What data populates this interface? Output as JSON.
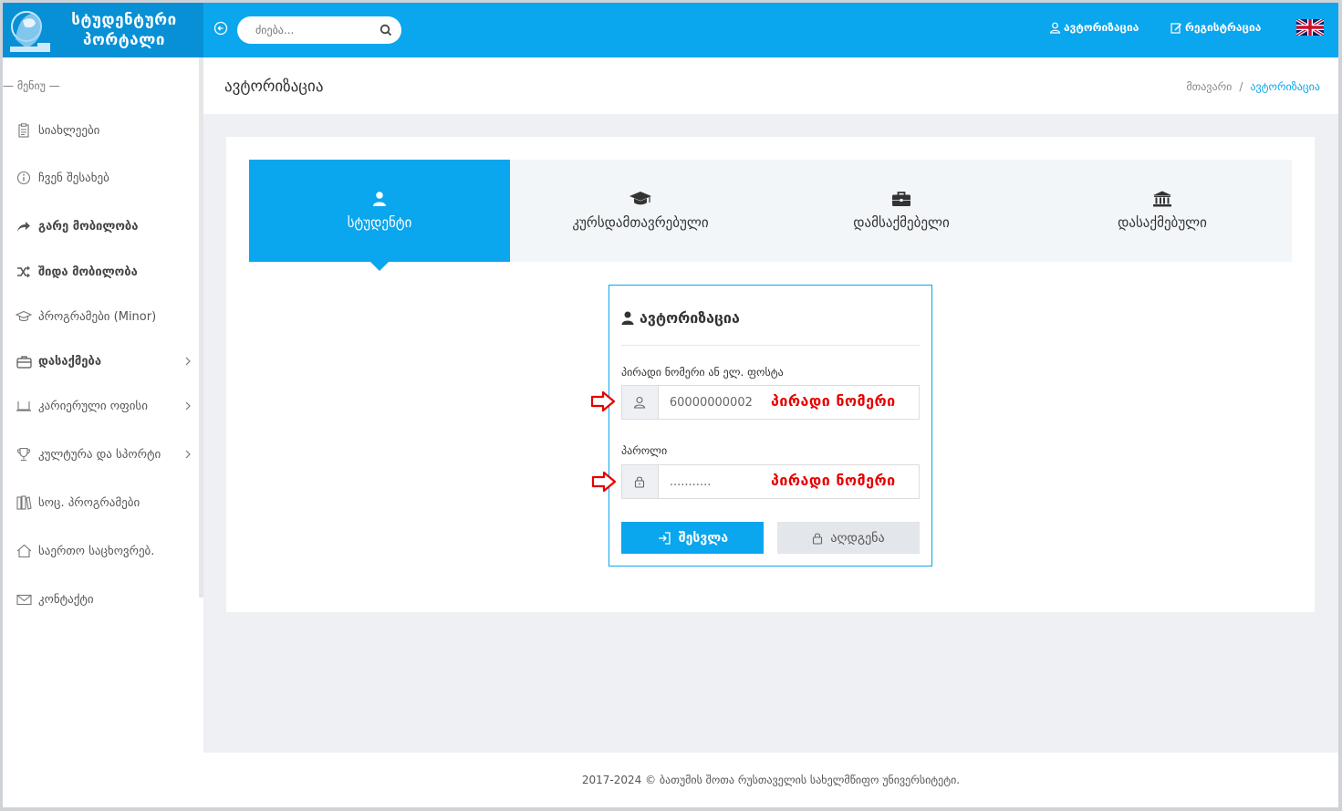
{
  "header": {
    "logo_line1": "სტუდენტური",
    "logo_line2": "პორტალი",
    "search_placeholder": "ძიება...",
    "auth_link": "ავტორიზაცია",
    "register_link": "რეგისტრაცია",
    "brand_color": "#0aa6ee"
  },
  "sidebar": {
    "title": "— მენიუ —",
    "items": [
      {
        "label": "სიახლეები",
        "icon": "clipboard-icon"
      },
      {
        "label": "ჩვენ შესახებ",
        "icon": "info-icon"
      },
      {
        "label": "გარე მობილობა",
        "icon": "share-arrow-icon"
      },
      {
        "label": "შიდა მობილობა",
        "icon": "shuffle-icon"
      },
      {
        "label": "პროგრამები (Minor)",
        "icon": "graduation-cap-icon"
      },
      {
        "label": "დასაქმება",
        "icon": "briefcase-icon"
      },
      {
        "label": "კარიერული ოფისი",
        "icon": "laptop-icon"
      },
      {
        "label": "კულტურა და სპორტი",
        "icon": "trophy-icon"
      },
      {
        "label": "სოც. პროგრამები",
        "icon": "books-icon"
      },
      {
        "label": "საერთო საცხოვრებ.",
        "icon": "home-icon"
      },
      {
        "label": "კონტაქტი",
        "icon": "envelope-icon"
      }
    ]
  },
  "page": {
    "title": "ავტორიზაცია",
    "breadcrumb_home": "მთავარი",
    "breadcrumb_sep": "/",
    "breadcrumb_current": "ავტორიზაცია"
  },
  "tabs": [
    {
      "label": "სტუდენტი",
      "icon": "user-icon",
      "active": true
    },
    {
      "label": "კურსდამთავრებული",
      "icon": "graduation-cap-icon",
      "active": false
    },
    {
      "label": "დამსაქმებელი",
      "icon": "briefcase-icon",
      "active": false
    },
    {
      "label": "დასაქმებული",
      "icon": "bank-icon",
      "active": false
    }
  ],
  "login": {
    "title": "ავტორიზაცია",
    "id_label": "პირადი ნომერი ან ელ. ფოსტა",
    "id_value": "60000000002",
    "password_label": "პაროლი",
    "password_value": "...........",
    "id_annotation": "პირადი ნომერი",
    "password_annotation": "პირადი ნომერი",
    "login_button": "შესვლა",
    "recover_button": "აღდგენა"
  },
  "footer": {
    "text": "2017-2024 © ბათუმის შოთა რუსთაველის სახელმწიფო უნივერსიტეტი."
  }
}
